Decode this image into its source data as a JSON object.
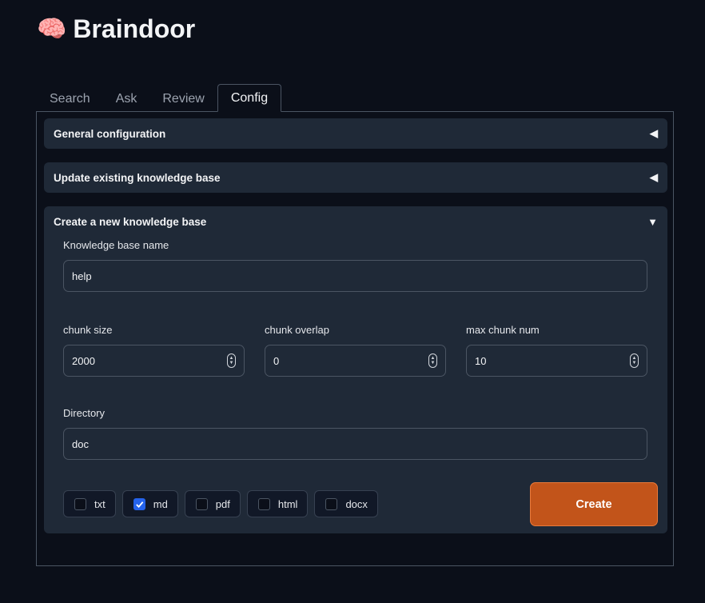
{
  "app": {
    "icon": "brain-icon",
    "emoji": "🧠",
    "title": "Braindoor"
  },
  "tabs": [
    {
      "label": "Search",
      "active": false
    },
    {
      "label": "Ask",
      "active": false
    },
    {
      "label": "Review",
      "active": false
    },
    {
      "label": "Config",
      "active": true
    }
  ],
  "sections": {
    "general": {
      "title": "General configuration",
      "arrow": "◀",
      "expanded": false
    },
    "update": {
      "title": "Update existing knowledge base",
      "arrow": "◀",
      "expanded": false
    },
    "create": {
      "title": "Create a new knowledge base",
      "arrow": "▼",
      "expanded": true
    }
  },
  "create_form": {
    "kb_name": {
      "label": "Knowledge base name",
      "value": "help"
    },
    "chunk_size": {
      "label": "chunk size",
      "value": "2000"
    },
    "chunk_overlap": {
      "label": "chunk overlap",
      "value": "0"
    },
    "max_chunk_num": {
      "label": "max chunk num",
      "value": "10"
    },
    "directory": {
      "label": "Directory",
      "value": "doc"
    },
    "file_types": [
      {
        "label": "txt",
        "checked": false
      },
      {
        "label": "md",
        "checked": true
      },
      {
        "label": "pdf",
        "checked": false
      },
      {
        "label": "html",
        "checked": false
      },
      {
        "label": "docx",
        "checked": false
      }
    ],
    "create_button": "Create"
  },
  "colors": {
    "background": "#0b0f19",
    "panel": "#1f2937",
    "accent": "#c2541a",
    "checkbox": "#2563eb"
  }
}
